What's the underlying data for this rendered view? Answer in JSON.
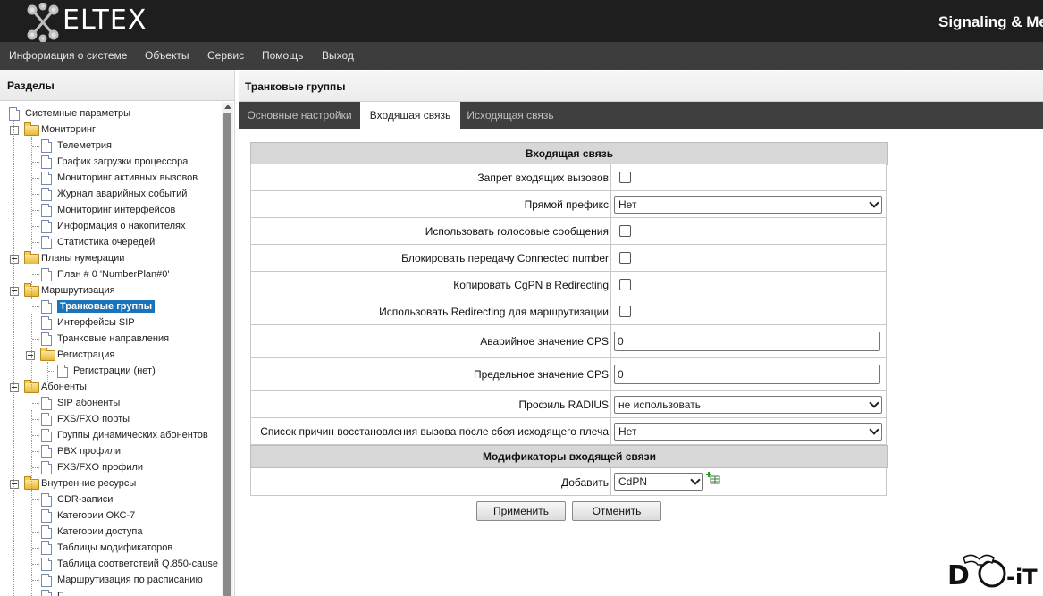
{
  "header": {
    "logo_text": "ELTEX",
    "product_title": "Signaling & Me"
  },
  "menu": [
    "Информация о системе",
    "Объекты",
    "Сервис",
    "Помощь",
    "Выход"
  ],
  "sidebar": {
    "title": "Разделы",
    "tree": [
      {
        "label": "Системные параметры",
        "kind": "doc"
      },
      {
        "label": "Мониторинг",
        "kind": "folder"
      },
      {
        "label": "Телеметрия",
        "kind": "doc"
      },
      {
        "label": "График загрузки процессора",
        "kind": "doc"
      },
      {
        "label": "Мониторинг активных вызовов",
        "kind": "doc"
      },
      {
        "label": "Журнал аварийных событий",
        "kind": "doc"
      },
      {
        "label": "Мониторинг интерфейсов",
        "kind": "doc"
      },
      {
        "label": "Информация о накопителях",
        "kind": "doc"
      },
      {
        "label": "Статистика очередей",
        "kind": "doc"
      },
      {
        "label": "Планы нумерации",
        "kind": "folder"
      },
      {
        "label": "План # 0 'NumberPlan#0'",
        "kind": "doc"
      },
      {
        "label": "Маршрутизация",
        "kind": "folder"
      },
      {
        "label": "Транковые группы",
        "kind": "doc",
        "selected": true
      },
      {
        "label": "Интерфейсы SIP",
        "kind": "doc"
      },
      {
        "label": "Транковые направления",
        "kind": "doc"
      },
      {
        "label": "Регистрация",
        "kind": "folder"
      },
      {
        "label": "Регистрации (нет)",
        "kind": "doc"
      },
      {
        "label": "Абоненты",
        "kind": "folder"
      },
      {
        "label": "SIP абоненты",
        "kind": "doc"
      },
      {
        "label": "FXS/FXO порты",
        "kind": "doc"
      },
      {
        "label": "Группы динамических абонентов",
        "kind": "doc"
      },
      {
        "label": "PBX профили",
        "kind": "doc"
      },
      {
        "label": "FXS/FXO профили",
        "kind": "doc"
      },
      {
        "label": "Внутренние ресурсы",
        "kind": "folder"
      },
      {
        "label": "CDR-записи",
        "kind": "doc"
      },
      {
        "label": "Категории ОКС-7",
        "kind": "doc"
      },
      {
        "label": "Категории доступа",
        "kind": "doc"
      },
      {
        "label": "Таблицы модификаторов",
        "kind": "doc"
      },
      {
        "label": "Таблица соответствий Q.850-cause",
        "kind": "doc"
      },
      {
        "label": "Маршрутизация по расписанию",
        "kind": "doc"
      },
      {
        "label": "П",
        "kind": "doc"
      }
    ]
  },
  "content": {
    "title": "Транковые группы",
    "tabs": [
      {
        "label": "Основные настройки",
        "active": false
      },
      {
        "label": "Входящая связь",
        "active": true
      },
      {
        "label": "Исходящая связь",
        "active": false
      }
    ],
    "section1_title": "Входящая связь",
    "fields": {
      "block_incoming": {
        "label": "Запрет входящих вызовов",
        "checked": false
      },
      "direct_prefix": {
        "label": "Прямой префикс",
        "value": "Нет"
      },
      "voice_messages": {
        "label": "Использовать голосовые сообщения",
        "checked": false
      },
      "block_connected": {
        "label": "Блокировать передачу Connected number",
        "checked": false
      },
      "copy_cgpn": {
        "label": "Копировать CgPN в Redirecting",
        "checked": false
      },
      "use_redirecting": {
        "label": "Использовать Redirecting для маршрутизации",
        "checked": false
      },
      "alarm_cps": {
        "label": "Аварийное значение CPS",
        "value": "0"
      },
      "limit_cps": {
        "label": "Предельное значение CPS",
        "value": "0"
      },
      "radius_profile": {
        "label": "Профиль RADIUS",
        "value": "не использовать"
      },
      "failover_causes": {
        "label": "Список причин восстановления вызова после сбоя исходящего плеча",
        "value": "Нет"
      }
    },
    "section2_title": "Модификаторы входящей связи",
    "modifiers": {
      "label": "Добавить",
      "value": "CdPN"
    },
    "buttons": {
      "apply": "Применить",
      "cancel": "Отменить"
    }
  }
}
